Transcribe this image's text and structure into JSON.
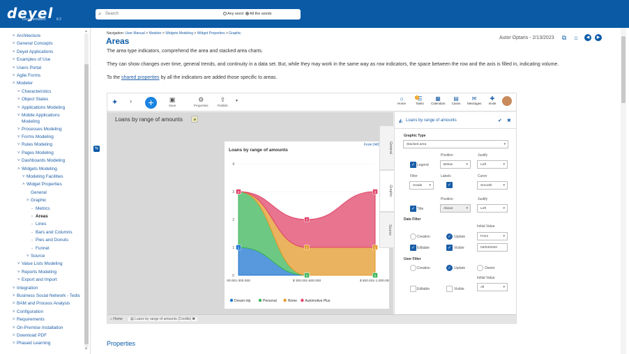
{
  "header": {
    "logo": "deyel",
    "logo_sub": "Documentation",
    "logo_version": "8.2",
    "search_placeholder": "Search",
    "radio_any": "Any word",
    "radio_all": "All the words"
  },
  "sidebar": {
    "items": [
      {
        "label": "Architecture",
        "level": 1,
        "chev": "˅"
      },
      {
        "label": "General Concepts",
        "level": 1,
        "chev": "˅"
      },
      {
        "label": "Deyel Applications",
        "level": 1,
        "chev": "˅"
      },
      {
        "label": "Examples of Use",
        "level": 1,
        "chev": "˅"
      },
      {
        "label": "Users Portal",
        "level": 1,
        "chev": "˅"
      },
      {
        "label": "Agile Forms",
        "level": 1,
        "chev": "˅"
      },
      {
        "label": "Modeler",
        "level": 1,
        "chev": "˄"
      },
      {
        "label": "Characteristics",
        "level": 2,
        "chev": "˅"
      },
      {
        "label": "Object States",
        "level": 2,
        "chev": "˅"
      },
      {
        "label": "Applications Modeling",
        "level": 2,
        "chev": "˅"
      },
      {
        "label": "Mobile Applications",
        "level": 2,
        "chev": "˅"
      },
      {
        "label": "Modeling",
        "level": 2,
        "chev": ""
      },
      {
        "label": "Processes Modeling",
        "level": 2,
        "chev": "˅"
      },
      {
        "label": "Forms Modeling",
        "level": 2,
        "chev": "˅"
      },
      {
        "label": "Rules Modeling",
        "level": 2,
        "chev": "˅"
      },
      {
        "label": "Pages Modeling",
        "level": 2,
        "chev": "˅"
      },
      {
        "label": "Dashboards Modeling",
        "level": 2,
        "chev": "˅"
      },
      {
        "label": "Widgets Modeling",
        "level": 2,
        "chev": "˄"
      },
      {
        "label": "Modeling Facilities",
        "level": 3,
        "chev": "˅"
      },
      {
        "label": "Widget Properties",
        "level": 3,
        "chev": "˄"
      },
      {
        "label": "General",
        "level": 4,
        "chev": ""
      },
      {
        "label": "Graphic",
        "level": 4,
        "chev": "˄"
      },
      {
        "label": "Metrics",
        "level": 5,
        "chev": "-"
      },
      {
        "label": "Areas",
        "level": 5,
        "chev": "-",
        "active": true
      },
      {
        "label": "Lines",
        "level": 5,
        "chev": "-"
      },
      {
        "label": "Bars and Columns",
        "level": 5,
        "chev": "-"
      },
      {
        "label": "Pies and Donuts",
        "level": 5,
        "chev": "-"
      },
      {
        "label": "Funnel",
        "level": 5,
        "chev": "-"
      },
      {
        "label": "Source",
        "level": 4,
        "chev": "˅"
      },
      {
        "label": "Value Lists Modeling",
        "level": 2,
        "chev": "˅"
      },
      {
        "label": "Reports Modeling",
        "level": 2,
        "chev": "˅"
      },
      {
        "label": "Export and Import",
        "level": 2,
        "chev": "˅"
      },
      {
        "label": "Integration",
        "level": 1,
        "chev": "˅"
      },
      {
        "label": "Business Social Network - Tedis",
        "level": 1,
        "chev": "˅"
      },
      {
        "label": "BAM and Process Analysis",
        "level": 1,
        "chev": "˅"
      },
      {
        "label": "Configuration",
        "level": 1,
        "chev": "˅"
      },
      {
        "label": "Requirements",
        "level": 1,
        "chev": "˅"
      },
      {
        "label": "On-Premise Installation",
        "level": 1,
        "chev": "˅"
      },
      {
        "label": "Download PDF",
        "level": 1,
        "chev": "˅"
      },
      {
        "label": "Phased Learning",
        "level": 1,
        "chev": "˅"
      }
    ]
  },
  "content": {
    "breadcrumb_prefix": "Navigation:",
    "breadcrumb": [
      "User Manual",
      "Modeler",
      "Widgets Modeling",
      "Widget Properties",
      "Graphic"
    ],
    "title": "Areas",
    "author": "Autor Optaris - 2/13/2023",
    "para1": "The area type indicators, comprehend the area and stacked area charts.",
    "para2": "They can show changes over time, general trends, and continuity in a data set. But, while they may work in the same way as row indicators, the space between the row and the axis is filled in, indicating volume.",
    "para3_pre": "To the ",
    "para3_link": "shared properties",
    "para3_post": " by all the indicators are added those specific to areas.",
    "properties_heading": "Properties"
  },
  "app": {
    "toolbar": {
      "save": "Save",
      "properties": "Properties",
      "publish": "Publish"
    },
    "right_toolbar": [
      "Home",
      "Tasks",
      "Calendars",
      "Cases",
      "Messages",
      "Invite"
    ],
    "tasks_badge": "3",
    "widget_title": "Loans by range of amounts",
    "bottom_tabs": {
      "home": "Home",
      "current": "Loans by range of amounts (Credits)"
    },
    "vertical_tabs": [
      "General",
      "Graphic",
      "Source"
    ],
    "panel": {
      "title": "Loans by range of amounts",
      "graphic_type_label": "Graphic Type",
      "graphic_type_value": "Stacked area",
      "position_label": "Position",
      "justify_label": "Justify",
      "legend_label": "Legend",
      "legend_position": "Below",
      "legend_justify": "Left",
      "filler_label": "Filler",
      "filler_value": "Grade",
      "labels_label": "Labels",
      "curve_label": "Curve",
      "curve_value": "Smooth",
      "title_label": "Title",
      "title_position": "Above",
      "title_justify": "Left",
      "date_filter_label": "Date Filter",
      "creation_label": "Creation",
      "update_label": "Update",
      "initial_value_label": "Initial Value",
      "initial_value": "From",
      "editable_label": "Editable",
      "visible_label": "Visible",
      "date_value": "04/03/2020",
      "user_filter_label": "User Filter",
      "owner_label": "Owner",
      "user_initial_value": "All"
    }
  },
  "chart_data": {
    "type": "area",
    "stacked": true,
    "title": "Loans by range of amounts",
    "range_label": "From 04/0",
    "categories": [
      "00.001-300.000",
      "$ 300.001-500.000",
      "$ 500.001-1.000.000"
    ],
    "ylim": [
      0,
      4
    ],
    "yticks": [
      0,
      1,
      2,
      3,
      4
    ],
    "series": [
      {
        "name": "Dream trip",
        "values": [
          1,
          0,
          0
        ],
        "color": "#1f77d0"
      },
      {
        "name": "Personal",
        "values": [
          2,
          0,
          0
        ],
        "color": "#3cb55a"
      },
      {
        "name": "Home",
        "values": [
          0,
          1,
          1
        ],
        "color": "#e39a2a"
      },
      {
        "name": "Automotive Plus",
        "values": [
          0,
          1,
          2
        ],
        "color": "#e0456a"
      }
    ],
    "point_labels": [
      [
        1,
        0,
        0
      ],
      [
        3,
        0,
        0
      ],
      [
        3,
        1,
        1
      ],
      [
        3,
        2,
        3
      ]
    ],
    "legend_position": "bottom"
  }
}
